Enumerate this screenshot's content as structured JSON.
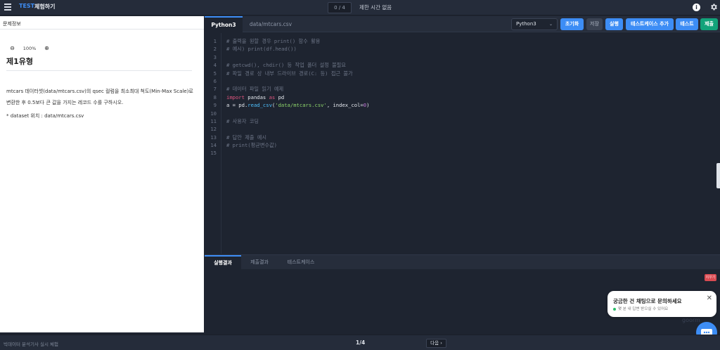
{
  "topbar": {
    "brand": "TEST",
    "title": "체험하기",
    "counter": "0 / 4",
    "timer": "제한 시간 없음",
    "info_glyph": "i"
  },
  "left": {
    "header": "문제정보",
    "zoom": "100%",
    "title": "제1유형",
    "paragraphs": [
      "mtcars 데이터셋(data/mtcars.csv)의 qsec 컬럼을 최소최대 척도(Min-Max Scale)로 변환한 후 0.5보다 큰 값을 가지는 레코드 수를 구하시오.",
      "* dataset 위치 : data/mtcars.csv"
    ]
  },
  "editor": {
    "tabs": [
      "Python3",
      "data/mtcars.csv"
    ],
    "language": "Python3",
    "buttons": {
      "reset": "초기화",
      "save": "저장",
      "run": "실행",
      "add_testcase": "테스트케이스 추가",
      "test": "테스트",
      "submit": "제출"
    },
    "line_numbers": [
      "1",
      "2",
      "3",
      "4",
      "5",
      "6",
      "7",
      "8",
      "9",
      "10",
      "11",
      "12",
      "13",
      "14",
      "15"
    ],
    "code": {
      "l1": "# 출력을 원할 경우 print() 함수 활용",
      "l2": "# 예시) print(df.head())",
      "l4": "# getcwd(), chdir() 등 작업 폴더 설정 불필요",
      "l5": "# 파일 경로 상 내부 드라이브 경로(C: 등) 접근 불가",
      "l7": "# 데이터 파일 읽기 예제",
      "l8_kw1": "import",
      "l8_mid": " pandas ",
      "l8_kw2": "as",
      "l8_end": " pd",
      "l9_a": "a = pd.",
      "l9_fn": "read_csv",
      "l9_p1": "(",
      "l9_str": "'data/mtcars.csv'",
      "l9_p2": ", index_col=",
      "l9_num": "0",
      "l9_p3": ")",
      "l11": "# 사용자 코딩",
      "l13": "# 답안 제출 예시",
      "l14": "# print(평균변수값)"
    }
  },
  "output": {
    "tabs": [
      "실행결과",
      "제출결과",
      "테스트케이스"
    ],
    "clear_badge": "지우기"
  },
  "chat": {
    "title": "궁금한 건 채팅으로 문의하세요",
    "subtitle": "몇 분 내 답변 받으실 수 있어요",
    "close": "✕",
    "watermark": "goorm"
  },
  "footer": {
    "left": "빅데이터 분석기사 실시 체험",
    "page": "1/4",
    "next": "다음 ›"
  }
}
